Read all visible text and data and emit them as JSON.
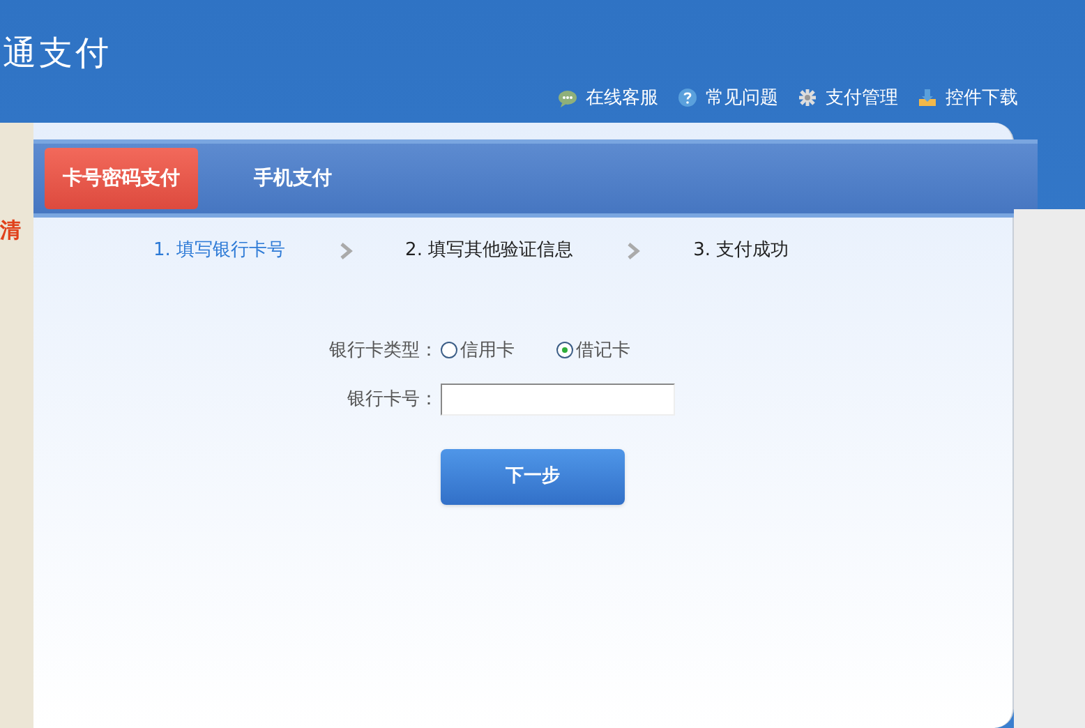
{
  "logo": {
    "text": "通支付"
  },
  "top_links": [
    {
      "kind": "chat",
      "label": "在线客服"
    },
    {
      "kind": "help",
      "label": "常见问题"
    },
    {
      "kind": "gear",
      "label": "支付管理"
    },
    {
      "kind": "download",
      "label": "控件下载"
    }
  ],
  "sidebar": {
    "text": "清"
  },
  "tabs": [
    {
      "label": "卡号密码支付",
      "selected": true
    },
    {
      "label": "手机支付",
      "selected": false
    }
  ],
  "steps": [
    {
      "label": "1. 填写银行卡号",
      "selected": true
    },
    {
      "label": "2. 填写其他验证信息",
      "selected": false
    },
    {
      "label": "3. 支付成功",
      "selected": false
    }
  ],
  "form": {
    "card_type_label": "银行卡类型：",
    "card_types": [
      {
        "label": "信用卡",
        "selected": false
      },
      {
        "label": "借记卡",
        "selected": true
      }
    ],
    "card_number_label": "银行卡号：",
    "next_button": "下一步"
  }
}
